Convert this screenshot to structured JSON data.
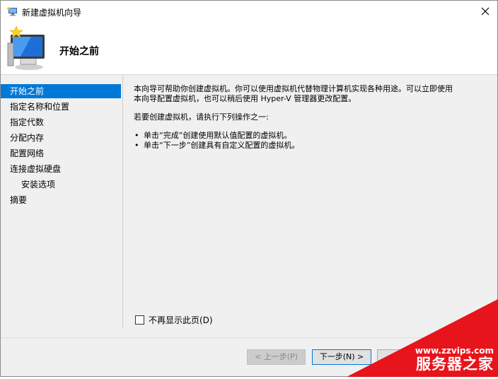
{
  "window": {
    "title": "新建虚拟机向导"
  },
  "header": {
    "title": "开始之前"
  },
  "sidebar": {
    "items": [
      {
        "label": "开始之前"
      },
      {
        "label": "指定名称和位置"
      },
      {
        "label": "指定代数"
      },
      {
        "label": "分配内存"
      },
      {
        "label": "配置网络"
      },
      {
        "label": "连接虚拟硬盘"
      },
      {
        "label": "安装选项"
      },
      {
        "label": "摘要"
      }
    ]
  },
  "content": {
    "para1_line1": "本向导可帮助你创建虚拟机。你可以使用虚拟机代替物理计算机实现各种用途。可以立即使用",
    "para1_line2": "本向导配置虚拟机，也可以稍后使用 Hyper-V 管理器更改配置。",
    "para2": "若要创建虚拟机，请执行下列操作之一:",
    "bullets": [
      "单击“完成”创建使用默认值配置的虚拟机。",
      "单击“下一步”创建具有自定义配置的虚拟机。"
    ]
  },
  "checkbox": {
    "label": "不再显示此页(D)",
    "checked": false
  },
  "buttons": {
    "prev": "< 上一步(P)",
    "next": "下一步(N) >",
    "more": ""
  },
  "watermark": {
    "url": "www.zzvips.com",
    "name": "服务器之家"
  },
  "colors": {
    "accent": "#0078d7",
    "watermark": "#e8141b"
  },
  "icons": {
    "title": "vm-wizard-icon",
    "header": "computer-star-icon",
    "close": "close-icon"
  }
}
